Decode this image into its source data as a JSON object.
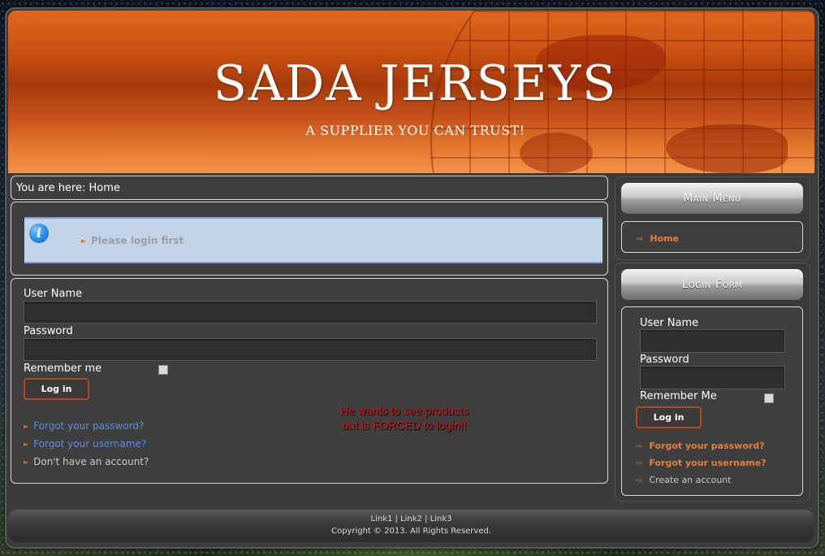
{
  "header": {
    "title": "SADA JERSEYS",
    "slogan": "A SUPPLIER YOU CAN TRUST!"
  },
  "breadcrumb": {
    "text": "You are here: Home"
  },
  "message": {
    "text": "Please login first",
    "icon": "info-icon"
  },
  "main_login": {
    "username_label": "User Name",
    "password_label": "Password",
    "remember_label": "Remember me",
    "login_button": "Log in",
    "links": [
      "Forgot your password?",
      "Forgot your username?",
      "Don't have an account?"
    ]
  },
  "annotation": {
    "line1": "He wants to see products",
    "line2": "but is FORCED to login!!"
  },
  "main_menu": {
    "title": "Main Menu",
    "items": [
      "Home"
    ]
  },
  "login_form": {
    "title": "Login Form",
    "username_label": "User Name",
    "password_label": "Password",
    "remember_label": "Remember Me",
    "login_button": "Log in",
    "links": [
      "Forgot your password?",
      "Forgot your username?",
      "Create an account"
    ]
  },
  "footer": {
    "link1": "Link1",
    "link2": "Link2",
    "link3": "Link3",
    "separator": " | ",
    "copyright": "Copyright © 2013. All Rights Reserved."
  },
  "colors": {
    "accent": "#e3652c",
    "link_blue": "#5b8ee6",
    "annotation_red": "#d01818"
  }
}
